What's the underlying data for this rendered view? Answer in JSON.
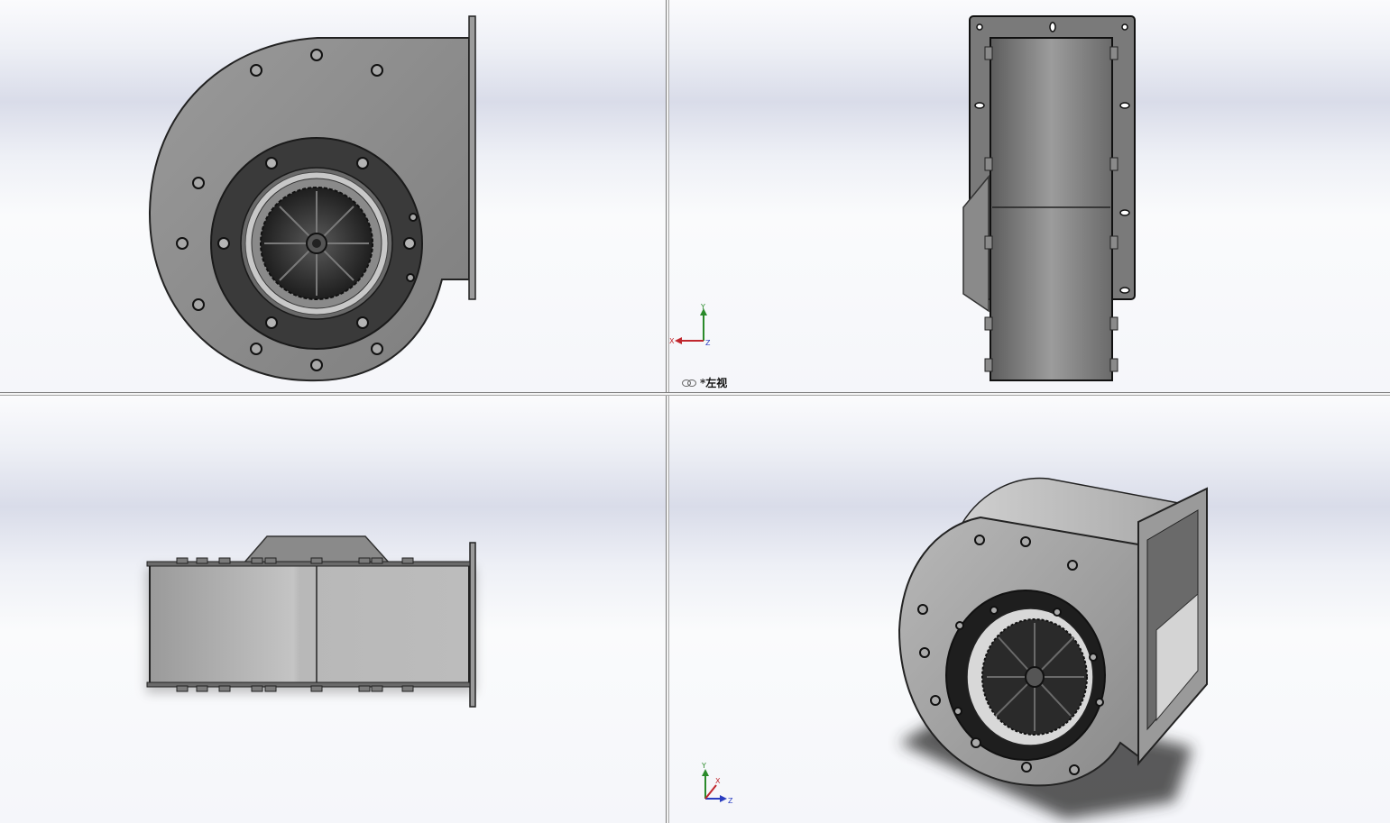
{
  "viewports": {
    "top_left": {
      "name": "front-view"
    },
    "top_right": {
      "name": "left-view",
      "label": "*左视",
      "triad": {
        "x": "X",
        "y": "Y",
        "z": "Z"
      }
    },
    "bottom_left": {
      "name": "top-view"
    },
    "bottom_right": {
      "name": "isometric-view",
      "triad": {
        "x": "X",
        "y": "Y",
        "z": "Z"
      }
    }
  },
  "colors": {
    "housing": "#8c8c8c",
    "housing_dark": "#2e2e2e",
    "axis_x": "#c0272d",
    "axis_y": "#2a8a2a",
    "axis_z": "#2a3dc0",
    "splitter": "#7d7d7d"
  }
}
